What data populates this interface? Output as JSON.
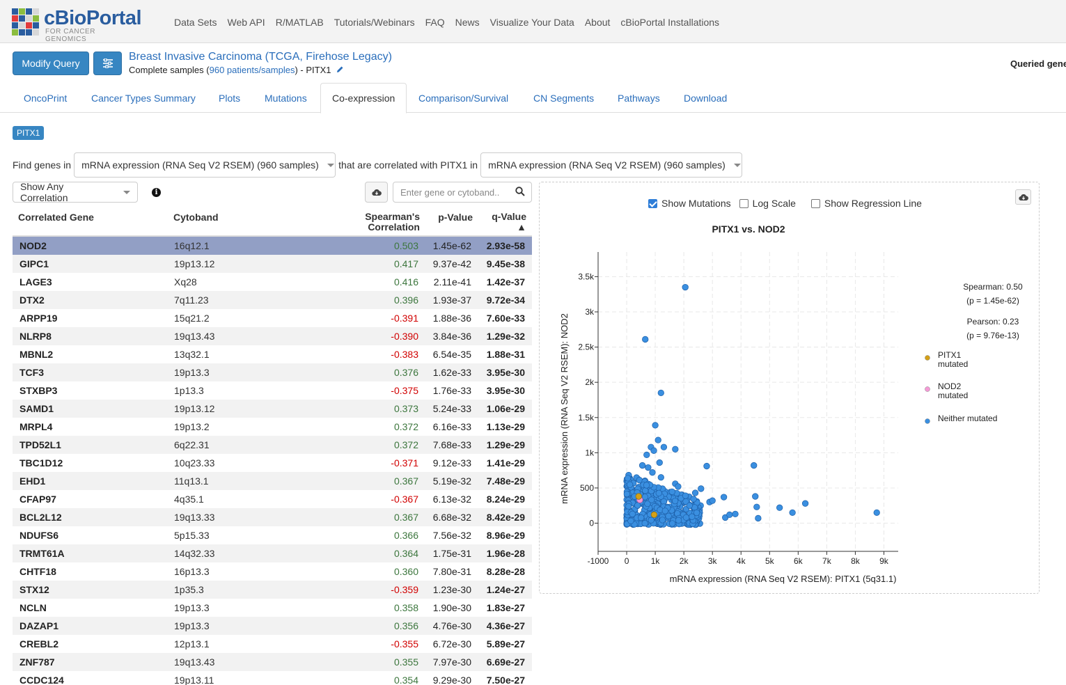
{
  "nav": {
    "logo_text": "cBioPortal",
    "logo_sub": "FOR CANCER GENOMICS",
    "links": [
      "Data Sets",
      "Web API",
      "R/MATLAB",
      "Tutorials/Webinars",
      "FAQ",
      "News",
      "Visualize Your Data",
      "About",
      "cBioPortal Installations"
    ]
  },
  "query": {
    "modify_label": "Modify Query",
    "study_title": "Breast Invasive Carcinoma (TCGA, Firehose Legacy)",
    "sub_prefix": "Complete samples (",
    "sub_link": "960 patients/samples",
    "sub_suffix": ")  - PITX1",
    "queried_label": "Queried gene"
  },
  "tabs": [
    "OncoPrint",
    "Cancer Types Summary",
    "Plots",
    "Mutations",
    "Co-expression",
    "Comparison/Survival",
    "CN Segments",
    "Pathways",
    "Download"
  ],
  "active_tab": "Co-expression",
  "gene_badge": "PITX1",
  "find": {
    "prefix": "Find genes in",
    "profile1": "mRNA expression (RNA Seq V2 RSEM) (960 samples)",
    "middle": "that are correlated with PITX1 in",
    "profile2": "mRNA expression (RNA Seq V2 RSEM) (960 samples)"
  },
  "filter": {
    "correlation_select": "Show Any Correlation",
    "search_placeholder": "Enter gene or cytoband.."
  },
  "table": {
    "headers": {
      "gene": "Correlated Gene",
      "cytoband": "Cytoband",
      "corr_line1": "Spearman's",
      "corr_line2": "Correlation",
      "pvalue": "p-Value",
      "qvalue": "q-Value",
      "sort_arrow": "▲"
    },
    "rows": [
      {
        "gene": "NOD2",
        "cyto": "16q12.1",
        "corr": "0.503",
        "p": "1.45e-62",
        "q": "2.93e-58"
      },
      {
        "gene": "GIPC1",
        "cyto": "19p13.12",
        "corr": "0.417",
        "p": "9.37e-42",
        "q": "9.45e-38"
      },
      {
        "gene": "LAGE3",
        "cyto": "Xq28",
        "corr": "0.416",
        "p": "2.11e-41",
        "q": "1.42e-37"
      },
      {
        "gene": "DTX2",
        "cyto": "7q11.23",
        "corr": "0.396",
        "p": "1.93e-37",
        "q": "9.72e-34"
      },
      {
        "gene": "ARPP19",
        "cyto": "15q21.2",
        "corr": "-0.391",
        "p": "1.88e-36",
        "q": "7.60e-33"
      },
      {
        "gene": "NLRP8",
        "cyto": "19q13.43",
        "corr": "-0.390",
        "p": "3.84e-36",
        "q": "1.29e-32"
      },
      {
        "gene": "MBNL2",
        "cyto": "13q32.1",
        "corr": "-0.383",
        "p": "6.54e-35",
        "q": "1.88e-31"
      },
      {
        "gene": "TCF3",
        "cyto": "19p13.3",
        "corr": "0.376",
        "p": "1.62e-33",
        "q": "3.95e-30"
      },
      {
        "gene": "STXBP3",
        "cyto": "1p13.3",
        "corr": "-0.375",
        "p": "1.76e-33",
        "q": "3.95e-30"
      },
      {
        "gene": "SAMD1",
        "cyto": "19p13.12",
        "corr": "0.373",
        "p": "5.24e-33",
        "q": "1.06e-29"
      },
      {
        "gene": "MRPL4",
        "cyto": "19p13.2",
        "corr": "0.372",
        "p": "6.16e-33",
        "q": "1.13e-29"
      },
      {
        "gene": "TPD52L1",
        "cyto": "6q22.31",
        "corr": "0.372",
        "p": "7.68e-33",
        "q": "1.29e-29"
      },
      {
        "gene": "TBC1D12",
        "cyto": "10q23.33",
        "corr": "-0.371",
        "p": "9.12e-33",
        "q": "1.41e-29"
      },
      {
        "gene": "EHD1",
        "cyto": "11q13.1",
        "corr": "0.367",
        "p": "5.19e-32",
        "q": "7.48e-29"
      },
      {
        "gene": "CFAP97",
        "cyto": "4q35.1",
        "corr": "-0.367",
        "p": "6.13e-32",
        "q": "8.24e-29"
      },
      {
        "gene": "BCL2L12",
        "cyto": "19q13.33",
        "corr": "0.367",
        "p": "6.68e-32",
        "q": "8.42e-29"
      },
      {
        "gene": "NDUFS6",
        "cyto": "5p15.33",
        "corr": "0.366",
        "p": "7.56e-32",
        "q": "8.96e-29"
      },
      {
        "gene": "TRMT61A",
        "cyto": "14q32.33",
        "corr": "0.364",
        "p": "1.75e-31",
        "q": "1.96e-28"
      },
      {
        "gene": "CHTF18",
        "cyto": "16p13.3",
        "corr": "0.360",
        "p": "7.80e-31",
        "q": "8.28e-28"
      },
      {
        "gene": "STX12",
        "cyto": "1p35.3",
        "corr": "-0.359",
        "p": "1.23e-30",
        "q": "1.24e-27"
      },
      {
        "gene": "NCLN",
        "cyto": "19p13.3",
        "corr": "0.358",
        "p": "1.90e-30",
        "q": "1.83e-27"
      },
      {
        "gene": "DAZAP1",
        "cyto": "19p13.3",
        "corr": "0.356",
        "p": "4.76e-30",
        "q": "4.36e-27"
      },
      {
        "gene": "CREBL2",
        "cyto": "12p13.1",
        "corr": "-0.355",
        "p": "6.72e-30",
        "q": "5.89e-27"
      },
      {
        "gene": "ZNF787",
        "cyto": "19q13.43",
        "corr": "0.355",
        "p": "7.97e-30",
        "q": "6.69e-27"
      },
      {
        "gene": "CCDC124",
        "cyto": "19p13.11",
        "corr": "0.354",
        "p": "9.29e-30",
        "q": "7.50e-27"
      }
    ]
  },
  "plot_options": {
    "show_mutations": "Show Mutations",
    "log_scale": "Log Scale",
    "regression": "Show Regression Line",
    "show_mutations_checked": true,
    "log_scale_checked": false,
    "regression_checked": false
  },
  "colors": {
    "accent": "#3786c2",
    "positive": "#3c763d",
    "negative": "#d10000",
    "selected_row": "#929fc5",
    "neither": "#3a8fe0",
    "pitx1_mutated": "#d4a017",
    "nod2_mutated": "#f59ad6"
  },
  "chart_data": {
    "type": "scatter",
    "title": "PITX1 vs. NOD2",
    "xlabel": "mRNA expression (RNA Seq V2 RSEM): PITX1 (5q31.1)",
    "ylabel": "mRNA expression (RNA Seq V2 RSEM): NOD2",
    "xlim": [
      -1000,
      9500
    ],
    "ylim": [
      -400,
      3850
    ],
    "x_ticks": [
      "-1000",
      "0",
      "1k",
      "2k",
      "3k",
      "4k",
      "5k",
      "6k",
      "7k",
      "8k",
      "9k"
    ],
    "x_tick_values": [
      -1000,
      0,
      1000,
      2000,
      3000,
      4000,
      5000,
      6000,
      7000,
      8000,
      9000
    ],
    "y_ticks": [
      "0",
      "500",
      "1k",
      "1.5k",
      "2k",
      "2.5k",
      "3k",
      "3.5k"
    ],
    "y_tick_values": [
      0,
      500,
      1000,
      1500,
      2000,
      2500,
      3000,
      3500
    ],
    "grid": true,
    "legend_position": "right",
    "stats": {
      "spearman": "Spearman: 0.50",
      "spearman_p": "(p = 1.45e-62)",
      "pearson": "Pearson: 0.23",
      "pearson_p": "(p = 9.76e-13)"
    },
    "series": [
      {
        "name": "PITX1 mutated",
        "legend": [
          "PITX1",
          "mutated"
        ],
        "color": "#d4a017",
        "points": [
          [
            960,
            120
          ],
          [
            420,
            380
          ]
        ]
      },
      {
        "name": "NOD2 mutated",
        "legend": [
          "NOD2",
          "mutated"
        ],
        "color": "#f59ad6",
        "points": [
          [
            460,
            330
          ]
        ]
      },
      {
        "name": "Neither mutated",
        "legend": [
          "Neither mutated"
        ],
        "color": "#3a8fe0",
        "points": [
          [
            2050,
            3350
          ],
          [
            650,
            2610
          ],
          [
            1200,
            1850
          ],
          [
            1000,
            1390
          ],
          [
            8750,
            150
          ],
          [
            6250,
            280
          ],
          [
            5800,
            150
          ],
          [
            5350,
            220
          ],
          [
            4450,
            820
          ],
          [
            4500,
            380
          ],
          [
            4550,
            230
          ],
          [
            4600,
            70
          ],
          [
            3450,
            80
          ],
          [
            3400,
            370
          ],
          [
            3600,
            120
          ],
          [
            3800,
            130
          ],
          [
            2800,
            810
          ],
          [
            1700,
            1050
          ],
          [
            1300,
            1080
          ],
          [
            1100,
            1180
          ],
          [
            850,
            1080
          ],
          [
            950,
            1030
          ],
          [
            700,
            970
          ],
          [
            1150,
            860
          ],
          [
            550,
            820
          ],
          [
            750,
            790
          ],
          [
            900,
            720
          ],
          [
            1200,
            650
          ],
          [
            1700,
            560
          ],
          [
            1800,
            520
          ],
          [
            2600,
            490
          ],
          [
            2900,
            300
          ],
          [
            3000,
            320
          ],
          [
            2400,
            430
          ],
          [
            2200,
            250
          ]
        ]
      },
      {
        "name": "Neither mutated cluster",
        "legend": [],
        "color": "#3a8fe0",
        "cluster": true,
        "count": 450,
        "x_range": [
          0,
          2600
        ],
        "y_range": [
          -20,
          700
        ]
      }
    ]
  }
}
